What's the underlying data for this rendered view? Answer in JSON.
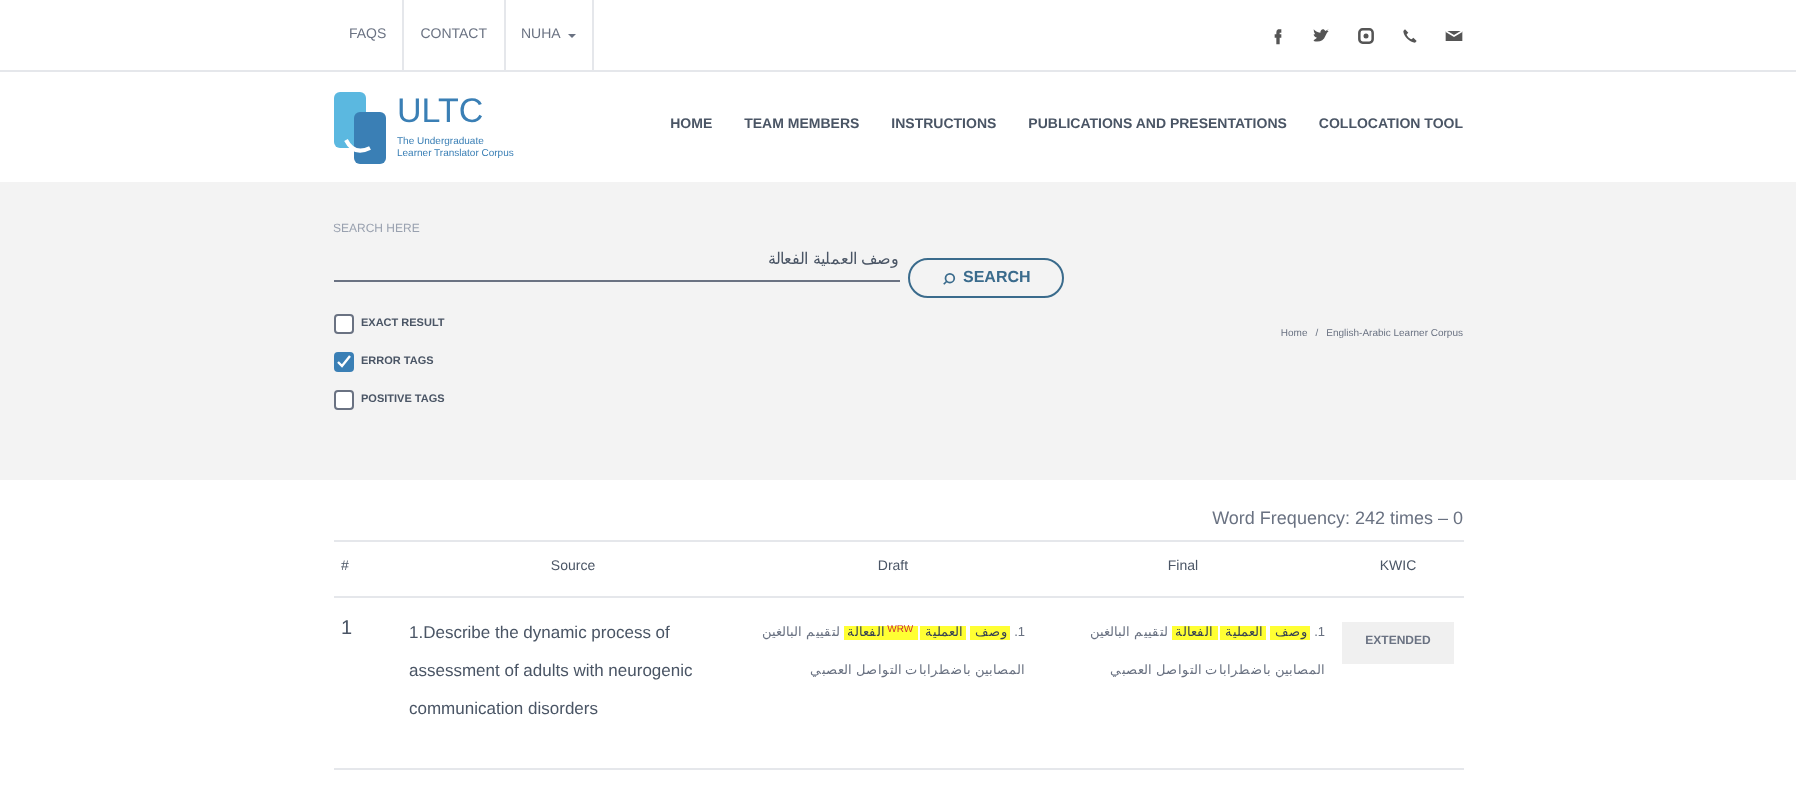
{
  "top_bar": {
    "links": [
      {
        "label": "FAQS",
        "dropdown": false
      },
      {
        "label": "CONTACT",
        "dropdown": false
      },
      {
        "label": "NUHA",
        "dropdown": true
      }
    ],
    "social": [
      {
        "kind": "facebook"
      },
      {
        "kind": "twitter"
      },
      {
        "kind": "instagram"
      },
      {
        "kind": "phone"
      },
      {
        "kind": "mail"
      }
    ]
  },
  "header": {
    "logo": {
      "title": "ULTC",
      "subtitle": [
        "The Undergraduate",
        "Learner Translator Corpus"
      ]
    },
    "nav": [
      "HOME",
      "TEAM MEMBERS",
      "INSTRUCTIONS",
      "PUBLICATIONS AND PRESENTATIONS",
      "COLLOCATION TOOL"
    ]
  },
  "search": {
    "label": "SEARCH HERE",
    "value": "وصف العملية الفعالة",
    "button": "SEARCH",
    "options": [
      {
        "label": "EXACT RESULT",
        "checked": false
      },
      {
        "label": "ERROR TAGS",
        "checked": true
      },
      {
        "label": "POSITIVE TAGS",
        "checked": false
      }
    ]
  },
  "breadcrumb": {
    "items": [
      "Home",
      "English-Arabic Learner Corpus"
    ],
    "separator": "/"
  },
  "results": {
    "frequency": "Word Frequency: 242 times – 0",
    "columns": [
      "#",
      "Source",
      "Draft",
      "Final",
      "KWIC"
    ],
    "rows": [
      {
        "number": "1",
        "source": "1.Describe the dynamic process of assessment of adults with neurogenic communication disorders",
        "draft": [
          {
            "text": "1.",
            "highlight": false
          },
          {
            "text": "وصف",
            "highlight": true
          },
          {
            "text": "العملية",
            "highlight": true
          },
          {
            "text": "الفعالة",
            "highlight": true,
            "tag": "WRW"
          },
          {
            "text": "لتقييم البالغين المصابين باضطرابات التواصل العصبي",
            "highlight": false
          }
        ],
        "final": [
          {
            "text": "1.",
            "highlight": false
          },
          {
            "text": "وصف",
            "highlight": true
          },
          {
            "text": "العملية",
            "highlight": true
          },
          {
            "text": "الفعالة",
            "highlight": true
          },
          {
            "text": "لتقييم البالغين المصابين باضطرابات التواصل العصبي",
            "highlight": false
          }
        ],
        "button": "EXTENDED"
      }
    ]
  }
}
